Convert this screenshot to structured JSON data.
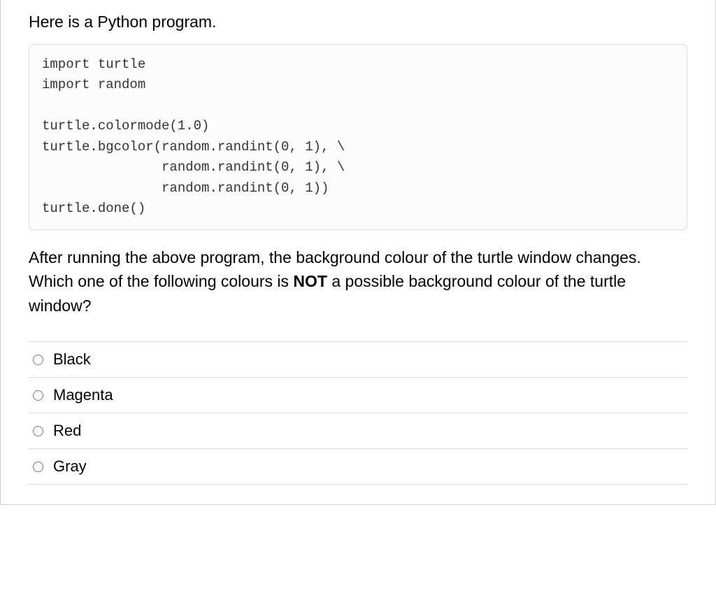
{
  "intro": "Here is a Python program.",
  "code": "import turtle\nimport random\n\nturtle.colormode(1.0)\nturtle.bgcolor(random.randint(0, 1), \\\n               random.randint(0, 1), \\\n               random.randint(0, 1))\nturtle.done()",
  "question": {
    "before_bold": "After running the above program, the background colour of the turtle window changes. Which one of the following colours is ",
    "bold": "NOT",
    "after_bold": " a possible background colour of the turtle window?"
  },
  "options": [
    {
      "label": "Black"
    },
    {
      "label": "Magenta"
    },
    {
      "label": "Red"
    },
    {
      "label": "Gray"
    }
  ]
}
